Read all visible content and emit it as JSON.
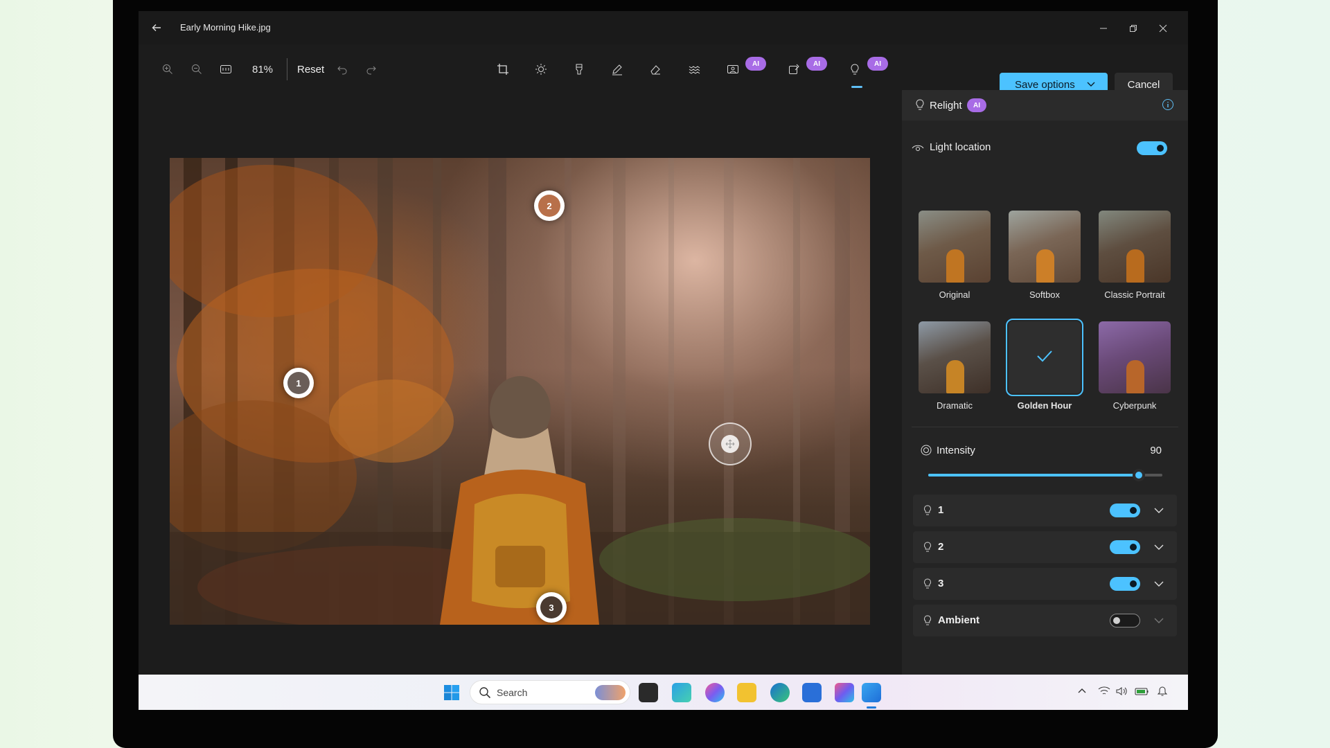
{
  "window": {
    "file_title": "Early Morning Hike.jpg"
  },
  "toolbar": {
    "zoom": "81%",
    "reset_label": "Reset",
    "ai_badge": "AI",
    "save_label": "Save options",
    "cancel_label": "Cancel"
  },
  "panel": {
    "title": "Relight",
    "ai_badge": "AI",
    "light_location": {
      "label": "Light location",
      "enabled": true
    },
    "presets": [
      {
        "label": "Original",
        "selected": false
      },
      {
        "label": "Softbox",
        "selected": false
      },
      {
        "label": "Classic Portrait",
        "selected": false
      },
      {
        "label": "Dramatic",
        "selected": false
      },
      {
        "label": "Golden Hour",
        "selected": true
      },
      {
        "label": "Cyberpunk",
        "selected": false
      }
    ],
    "intensity": {
      "label": "Intensity",
      "value": "90",
      "level": 0.9
    },
    "lights": [
      {
        "label": "1",
        "enabled": true
      },
      {
        "label": "2",
        "enabled": true
      },
      {
        "label": "3",
        "enabled": true
      },
      {
        "label": "Ambient",
        "enabled": false
      }
    ]
  },
  "canvas": {
    "markers": [
      "1",
      "2",
      "3"
    ]
  },
  "taskbar": {
    "search_placeholder": "Search"
  },
  "colors": {
    "accent": "#4cc2ff",
    "ai_badge": "#a86ce6",
    "marker_fill": "#b8704a"
  }
}
